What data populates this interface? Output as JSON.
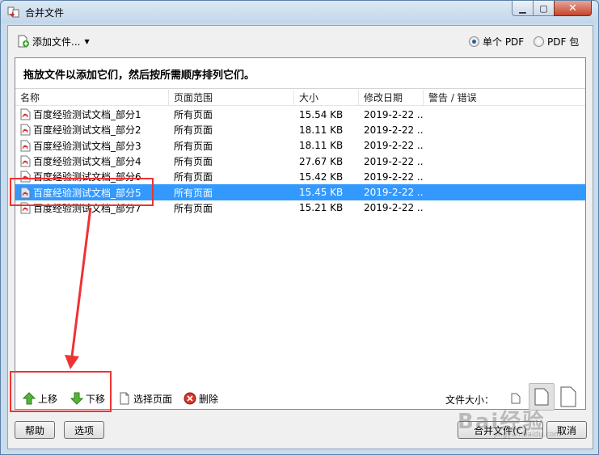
{
  "window": {
    "title": "合并文件"
  },
  "toolbar": {
    "add_files_label": "添加文件...",
    "output_options": [
      {
        "label": "单个 PDF",
        "selected": true
      },
      {
        "label": "PDF 包",
        "selected": false
      }
    ]
  },
  "instruction": "拖放文件以添加它们，然后按所需顺序排列它们。",
  "columns": [
    "名称",
    "页面范围",
    "大小",
    "修改日期",
    "警告 / 错误"
  ],
  "files": [
    {
      "name": "百度经验测试文档_部分1",
      "range": "所有页面",
      "size": "15.54 KB",
      "date": "2019-2-22 ...",
      "selected": false
    },
    {
      "name": "百度经验测试文档_部分2",
      "range": "所有页面",
      "size": "18.11 KB",
      "date": "2019-2-22 ...",
      "selected": false
    },
    {
      "name": "百度经验测试文档_部分3",
      "range": "所有页面",
      "size": "18.11 KB",
      "date": "2019-2-22 ...",
      "selected": false
    },
    {
      "name": "百度经验测试文档_部分4",
      "range": "所有页面",
      "size": "27.67 KB",
      "date": "2019-2-22 ...",
      "selected": false
    },
    {
      "name": "百度经验测试文档_部分6",
      "range": "所有页面",
      "size": "15.42 KB",
      "date": "2019-2-22 ...",
      "selected": false
    },
    {
      "name": "百度经验测试文档_部分5",
      "range": "所有页面",
      "size": "15.45 KB",
      "date": "2019-2-22 ...",
      "selected": true
    },
    {
      "name": "百度经验测试文档_部分7",
      "range": "所有页面",
      "size": "15.21 KB",
      "date": "2019-2-22 ...",
      "selected": false
    }
  ],
  "actions": {
    "move_up": "上移",
    "move_down": "下移",
    "select_pages": "选择页面",
    "delete": "删除",
    "file_size_label": "文件大小："
  },
  "buttons": {
    "help": "帮助",
    "options": "选项",
    "merge": "合并文件(C)",
    "cancel": "取消"
  },
  "colors": {
    "selection": "#3399ff",
    "annotation": "#ee3333",
    "move_up_arrow": "#4caf2a",
    "delete_icon": "#d9342b"
  },
  "watermark": {
    "text": "Bai经验",
    "sub": "jingyan.baidu.com"
  }
}
